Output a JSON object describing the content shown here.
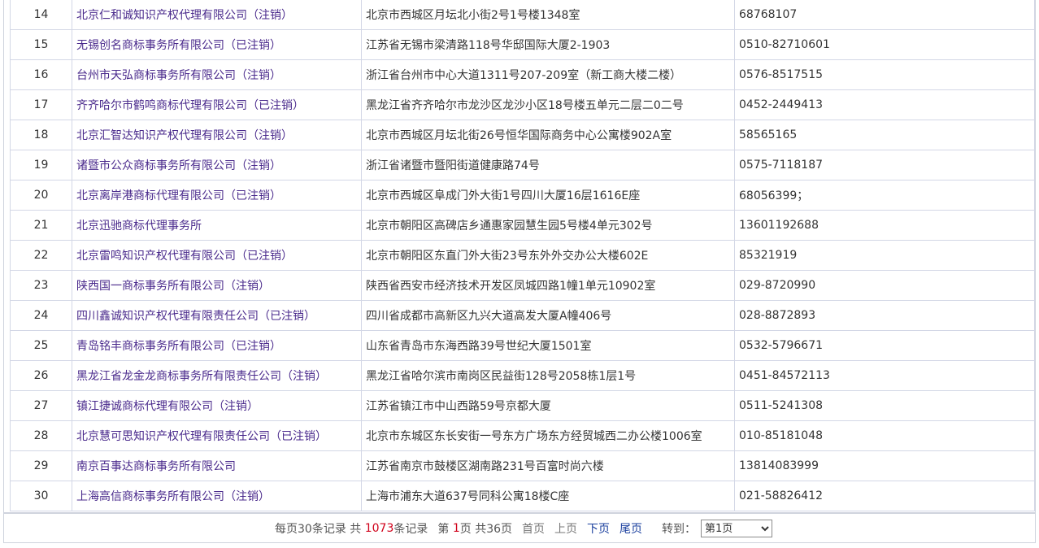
{
  "rows": [
    {
      "index": "14",
      "name": "北京仁和诚知识产权代理有限公司（注销）",
      "address": "北京市西城区月坛北小街2号1号楼1348室",
      "phone": "68768107"
    },
    {
      "index": "15",
      "name": "无锡创名商标事务所有限公司（已注销）",
      "address": "江苏省无锡市梁清路118号华邸国际大厦2-1903",
      "phone": "0510-82710601"
    },
    {
      "index": "16",
      "name": "台州市天弘商标事务所有限公司（注销）",
      "address": "浙江省台州市中心大道1311号207-209室（新工商大楼二楼）",
      "phone": "0576-8517515"
    },
    {
      "index": "17",
      "name": "齐齐哈尔市鹤鸣商标代理有限公司（已注销）",
      "address": "黑龙江省齐齐哈尔市龙沙区龙沙小区18号楼五单元二层二0二号",
      "phone": "0452-2449413"
    },
    {
      "index": "18",
      "name": "北京汇智达知识产权代理有限公司（注销）",
      "address": "北京市西城区月坛北街26号恒华国际商务中心公寓楼902A室",
      "phone": "58565165"
    },
    {
      "index": "19",
      "name": "诸暨市公众商标事务所有限公司（注销）",
      "address": "浙江省诸暨市暨阳街道健康路74号",
      "phone": "0575-7118187"
    },
    {
      "index": "20",
      "name": "北京离岸港商标代理有限公司（已注销）",
      "address": "北京市西城区阜成门外大街1号四川大厦16层1616E座",
      "phone": "68056399；"
    },
    {
      "index": "21",
      "name": "北京迅驰商标代理事务所",
      "address": "北京市朝阳区高碑店乡通惠家园慧生园5号楼4单元302号",
      "phone": "13601192688"
    },
    {
      "index": "22",
      "name": "北京雷鸣知识产权代理有限公司（已注销）",
      "address": "北京市朝阳区东直门外大街23号东外外交办公大楼602E",
      "phone": "85321919"
    },
    {
      "index": "23",
      "name": "陕西国一商标事务所有限公司（注销）",
      "address": "陕西省西安市经济技术开发区凤城四路1幢1单元10902室",
      "phone": "029-8720990"
    },
    {
      "index": "24",
      "name": "四川鑫诚知识产权代理有限责任公司（已注销）",
      "address": "四川省成都市高新区九兴大道高发大厦A幢406号",
      "phone": "028-8872893"
    },
    {
      "index": "25",
      "name": "青岛铭丰商标事务所有限公司（已注销）",
      "address": "山东省青岛市东海西路39号世纪大厦1501室",
      "phone": "0532-5796671"
    },
    {
      "index": "26",
      "name": "黑龙江省龙金龙商标事务所有限责任公司（注销）",
      "address": "黑龙江省哈尔滨市南岗区民益街128号2058栋1层1号",
      "phone": "0451-84572113"
    },
    {
      "index": "27",
      "name": "镇江捷诚商标代理有限公司（注销）",
      "address": "江苏省镇江市中山西路59号京都大厦",
      "phone": "0511-5241308"
    },
    {
      "index": "28",
      "name": "北京慧可思知识产权代理有限责任公司（已注销）",
      "address": "北京市东城区东长安街一号东方广场东方经贸城西二办公楼1006室",
      "phone": "010-85181048"
    },
    {
      "index": "29",
      "name": "南京百事达商标事务所有限公司",
      "address": "江苏省南京市鼓楼区湖南路231号百富时尚六楼",
      "phone": "13814083999"
    },
    {
      "index": "30",
      "name": "上海高信商标事务所有限公司（注销）",
      "address": "上海市浦东大道637号同科公寓18楼C座",
      "phone": "021-58826412"
    }
  ],
  "pager": {
    "per_page_text": "每页30条记录",
    "total_prefix": "共",
    "total_count": "1073",
    "total_suffix": "条记录",
    "page_prefix": "第",
    "current_page": "1",
    "page_suffix": "页",
    "total_pages_text": "共36页",
    "first_label": "首页",
    "prev_label": "上页",
    "next_label": "下页",
    "last_label": "尾页",
    "goto_label": "转到：",
    "goto_selected": "第1页",
    "colors": {
      "highlight": "#d0021b",
      "link": "#1a3f9e"
    }
  }
}
